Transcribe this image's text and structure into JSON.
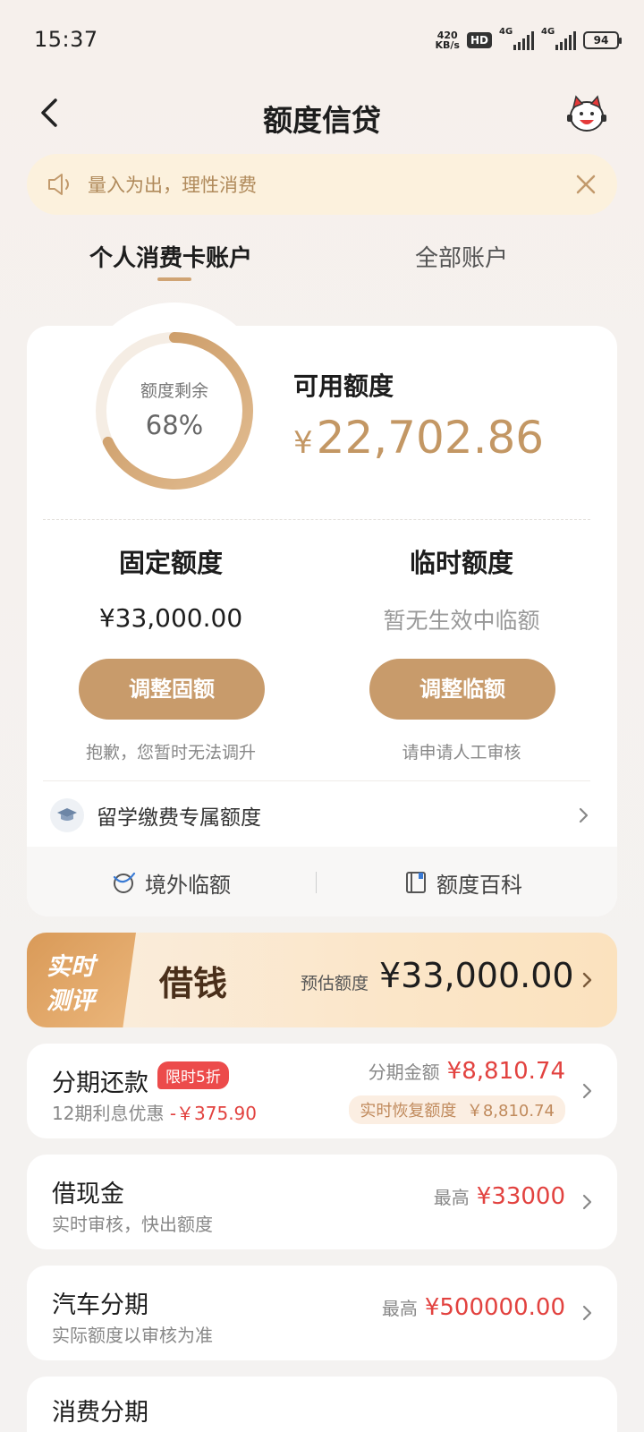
{
  "status_bar": {
    "time": "15:37",
    "net_speed_value": "420",
    "net_speed_unit": "KB/s",
    "hd_label": "HD",
    "signal_1_label": "4G",
    "signal_2_label": "4G",
    "battery": "94"
  },
  "nav": {
    "title": "额度信贷"
  },
  "notice": {
    "text": "量入为出，理性消费"
  },
  "tabs": [
    {
      "label": "个人消费卡账户",
      "active": true
    },
    {
      "label": "全部账户",
      "active": false
    }
  ],
  "credit": {
    "ring_label": "额度剩余",
    "ring_percent_text": "68%",
    "ring_fraction": 0.68,
    "available_label": "可用额度",
    "currency": "¥",
    "available_amount": "22,702.86",
    "fixed_title": "固定额度",
    "fixed_value": "¥33,000.00",
    "fixed_button": "调整固额",
    "fixed_note": "抱歉，您暂时无法调升",
    "temp_title": "临时额度",
    "temp_value": "暂无生效中临额",
    "temp_button": "调整临额",
    "temp_note": "请申请人工审核",
    "study_label": "留学缴费专属额度",
    "overseas_label": "境外临额",
    "encyclopedia_label": "额度百科"
  },
  "loan_banner": {
    "tag_line1": "实时",
    "tag_line2": "测评",
    "title": "借钱",
    "estimate_label": "预估额度",
    "estimate_amount": "¥33,000.00"
  },
  "installment": {
    "title": "分期还款",
    "badge": "限时5折",
    "sub_prefix": "12期利息优惠",
    "sub_discount": "-￥375.90",
    "amount_label": "分期金额",
    "amount_value": "¥8,810.74",
    "recover_label": "实时恢复额度",
    "recover_value": "￥8,810.74"
  },
  "cash": {
    "title": "借现金",
    "sub": "实时审核，快出额度",
    "max_label": "最高",
    "max_value": "¥33000"
  },
  "car": {
    "title": "汽车分期",
    "sub": "实际额度以审核为准",
    "max_label": "最高",
    "max_value": "¥500000.00"
  },
  "consumer": {
    "title": "消费分期"
  },
  "colors": {
    "accent_gold": "#c89b6b",
    "amount_gold": "#c39764",
    "red": "#e2423f",
    "notice_bg": "#fcf1dd"
  }
}
